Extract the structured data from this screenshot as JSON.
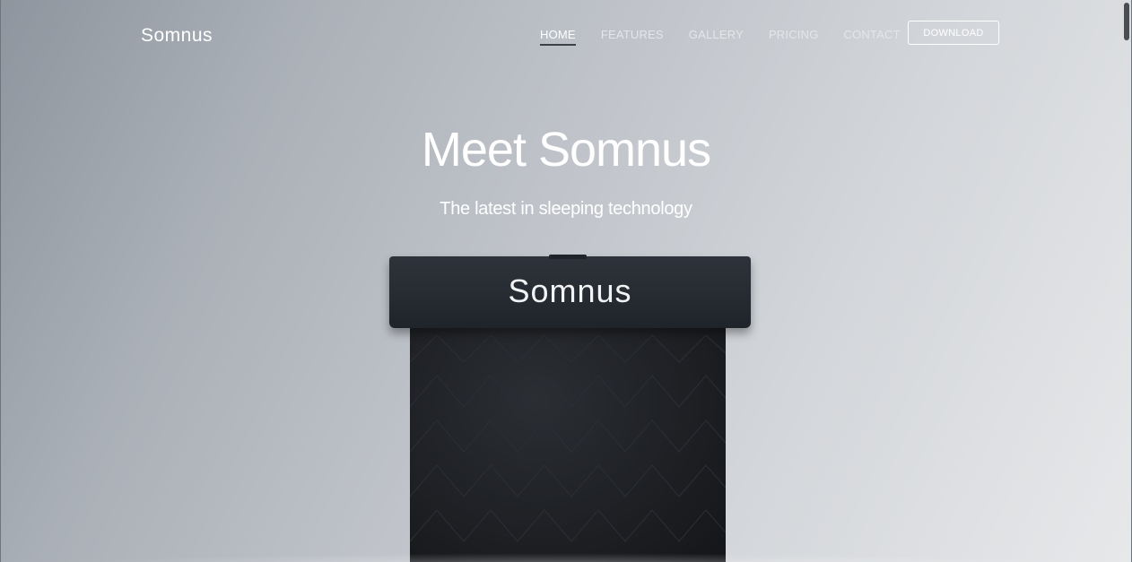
{
  "header": {
    "logo": "Somnus",
    "nav": [
      {
        "label": "HOME",
        "active": true
      },
      {
        "label": "FEATURES",
        "active": false
      },
      {
        "label": "GALLERY",
        "active": false
      },
      {
        "label": "PRICING",
        "active": false
      },
      {
        "label": "CONTACT",
        "active": false
      }
    ],
    "download_label": "DOWNLOAD"
  },
  "hero": {
    "title": "Meet Somnus",
    "subtitle": "The latest in sleeping technology",
    "device_logo": "Somnus"
  },
  "colors": {
    "text": "#ffffff",
    "nav_active_underline": "#3c4148",
    "device_dark": "#262a31"
  }
}
